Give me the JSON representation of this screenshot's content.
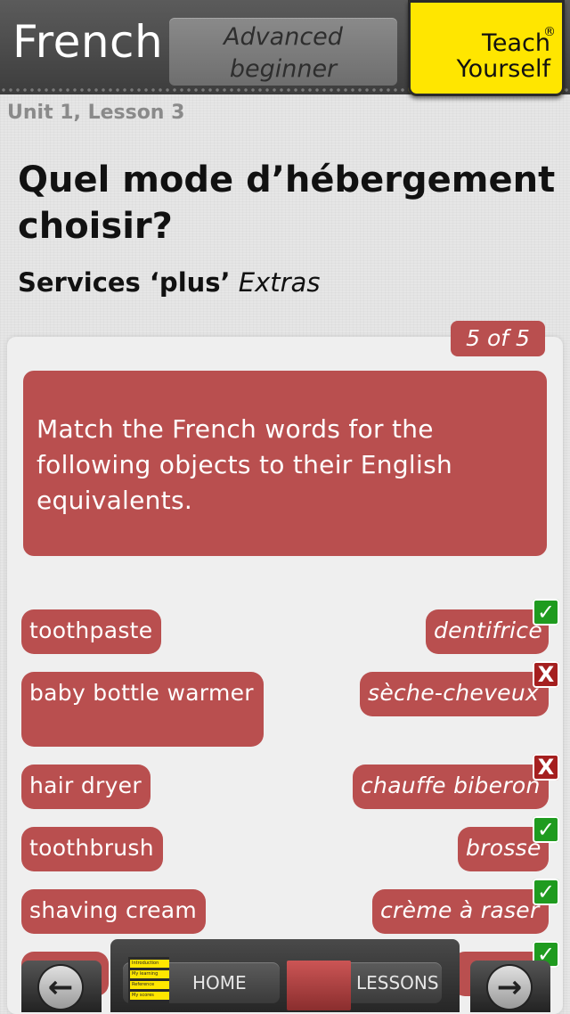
{
  "header": {
    "title": "French",
    "level": "Advanced beginner",
    "brand_line1": "Teach",
    "brand_line2": "Yourself",
    "brand_reg": "®"
  },
  "lesson": {
    "unit": "Unit 1, Lesson 3",
    "title": "Quel mode d’hébergement choisir?",
    "subtitle_bold": "Services ‘plus’",
    "subtitle_italic": "Extras"
  },
  "exercise": {
    "counter": "5 of 5",
    "instruction": "Match the French words for the following objects to their English equivalents."
  },
  "english_items": [
    "toothpaste",
    "baby bottle warmer",
    "hair dryer",
    "toothbrush",
    "shaving cream",
    ""
  ],
  "french_items": [
    {
      "text": "dentifrice",
      "status": "correct"
    },
    {
      "text": "sèche-cheveux",
      "status": "wrong"
    },
    {
      "text": "chauffe biberon",
      "status": "wrong"
    },
    {
      "text": "brosse",
      "status": "correct"
    },
    {
      "text": "crème à raser",
      "status": "correct"
    },
    {
      "text": "",
      "status": "correct"
    }
  ],
  "marks": {
    "correct": "✓",
    "wrong": "X"
  },
  "colors": {
    "accent_red": "#b94f4f",
    "brand_yellow": "#ffe600",
    "correct_green": "#1f9b1f",
    "wrong_red": "#a51f1f"
  },
  "nav": {
    "home_label": "HOME",
    "lessons_label": "LESSONS",
    "back_icon": "arrow-left-icon",
    "forward_icon": "arrow-right-icon",
    "home_thumb_items": [
      "Introduction",
      "My learning",
      "Reference",
      "My scores"
    ]
  }
}
